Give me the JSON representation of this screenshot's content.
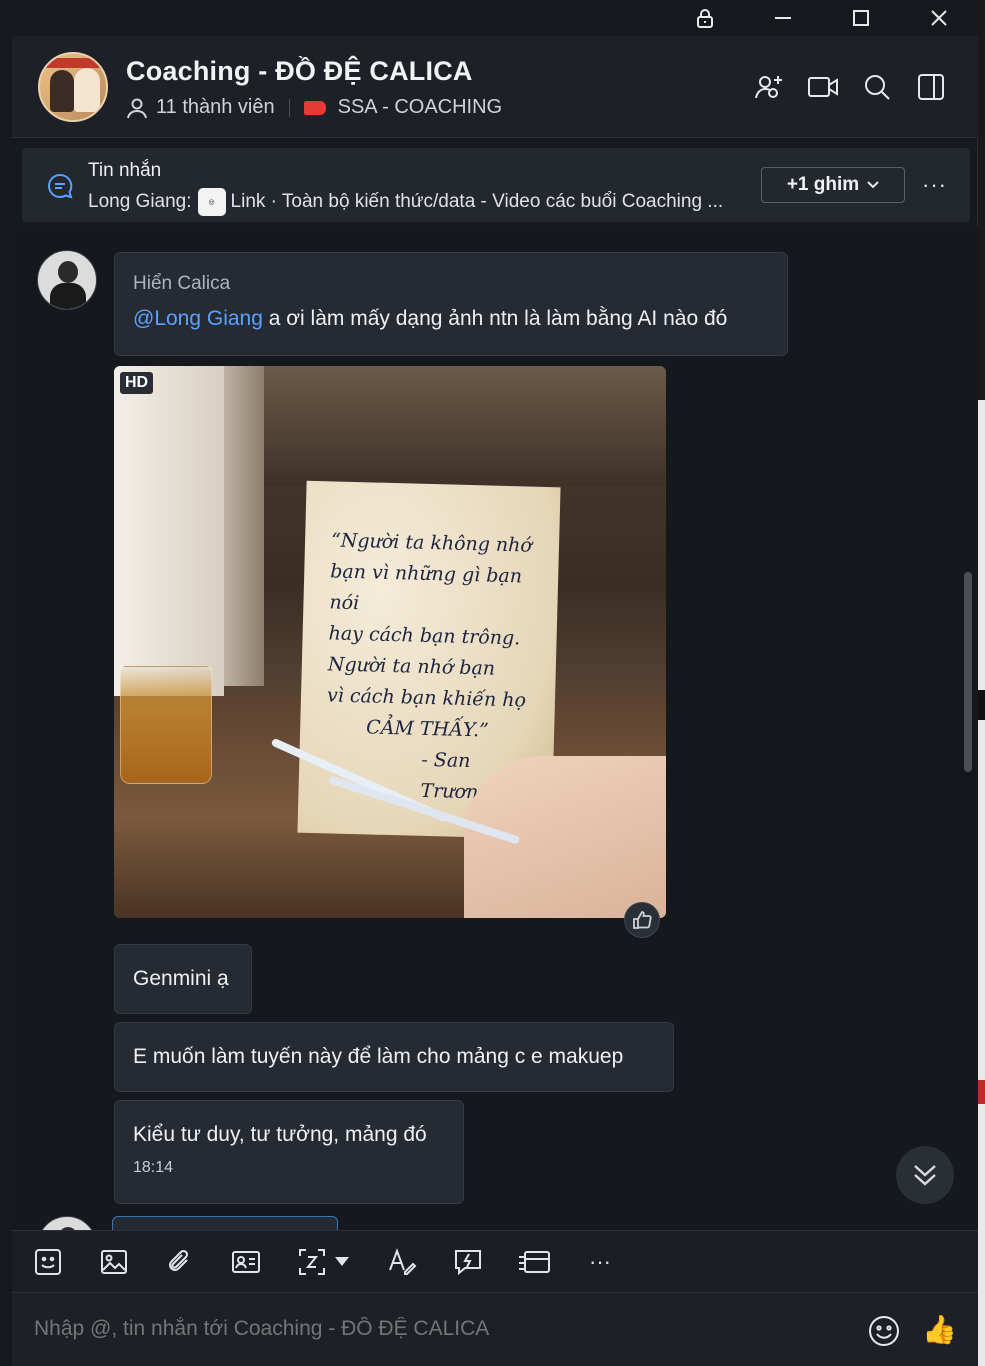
{
  "window": {
    "controls": [
      "lock-icon",
      "minimize-icon",
      "maximize-icon",
      "close-icon"
    ]
  },
  "header": {
    "title": "Coaching - ĐỒ ĐỆ CALICA",
    "members": "11 thành viên",
    "tag_label": "SSA - COACHING",
    "tag_color": "#e53935",
    "icons": [
      "add-member-icon",
      "video-call-icon",
      "search-icon",
      "sidebar-toggle-icon"
    ]
  },
  "pinned": {
    "title": "Tin nhắn",
    "sender": "Long Giang:",
    "text": "Link · Toàn bộ kiến thức/data - Video các buổi Coaching ...",
    "pin_count_label": "+1 ghim",
    "more_label": "···"
  },
  "messages": {
    "first": {
      "sender": "Hiển Calica",
      "mention": "@Long Giang",
      "text": " a ơi làm mấy dạng ảnh ntn là làm bằng AI nào đó"
    },
    "image": {
      "badge": "HD",
      "card_lines": [
        "“Người ta không nhớ",
        "bạn vì những gì bạn nói",
        "hay cách bạn trông.",
        "Người ta nhớ bạn",
        "vì cách bạn khiến họ",
        "CẢM THẤY.”",
        "- San Trương"
      ]
    },
    "m2": "Genmini ạ",
    "m3": "E muốn làm tuyến này để làm cho mảng c e makuep",
    "m4": "Kiểu tư duy, tư tưởng, mảng đó",
    "m4_time": "18:14"
  },
  "toolbar": {
    "tools": [
      "sticker-icon",
      "image-icon",
      "attachment-icon",
      "contact-card-icon",
      "screenshot-icon",
      "dropdown-icon",
      "text-format-icon",
      "quick-message-icon",
      "card-icon",
      "more-icon"
    ],
    "more_label": "···"
  },
  "composer": {
    "placeholder": "Nhập @, tin nhắn tới Coaching - ĐỒ ĐỆ CALICA",
    "thumb": "👍"
  }
}
